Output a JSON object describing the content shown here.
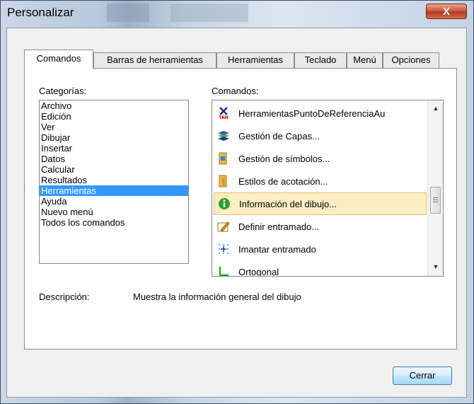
{
  "window": {
    "title": "Personalizar",
    "close_glyph": "X"
  },
  "tabs": [
    {
      "label": "Comandos",
      "active": true
    },
    {
      "label": "Barras de herramientas",
      "active": false
    },
    {
      "label": "Herramientas",
      "active": false
    },
    {
      "label": "Teclado",
      "active": false
    },
    {
      "label": "Menú",
      "active": false
    },
    {
      "label": "Opciones",
      "active": false
    }
  ],
  "categories": {
    "label": "Categorías:",
    "items": [
      "Archivo",
      "Edición",
      "Ver",
      "Dibujar",
      "Insertar",
      "Datos",
      "Calcular",
      "Resultados",
      "Herramientas",
      "Ayuda",
      "Nuevo menú",
      "Todos los comandos"
    ],
    "selected": "Herramientas"
  },
  "commands": {
    "label": "Comandos:",
    "items": [
      {
        "label": "HerramientasPuntoDeReferenciaAu",
        "icon": "tan-icon"
      },
      {
        "label": "Gestión de Capas...",
        "icon": "layers-icon"
      },
      {
        "label": "Gestión de símbolos...",
        "icon": "symbols-folder-icon"
      },
      {
        "label": "Estilos de acotación...",
        "icon": "dimension-styles-icon"
      },
      {
        "label": "Información del dibujo...",
        "icon": "info-icon",
        "highlighted": true
      },
      {
        "label": "Definir entramado...",
        "icon": "grid-edit-icon"
      },
      {
        "label": "Imantar entramado",
        "icon": "snap-grid-icon"
      },
      {
        "label": "Ortogonal",
        "icon": "ortho-icon"
      }
    ]
  },
  "description": {
    "label": "Descripción:",
    "text": "Muestra la información general del dibujo"
  },
  "buttons": {
    "close_label": "Cerrar"
  },
  "colors": {
    "selection": "#3399ff",
    "highlight": "#fbeec4",
    "close_button": "#c8452a"
  }
}
